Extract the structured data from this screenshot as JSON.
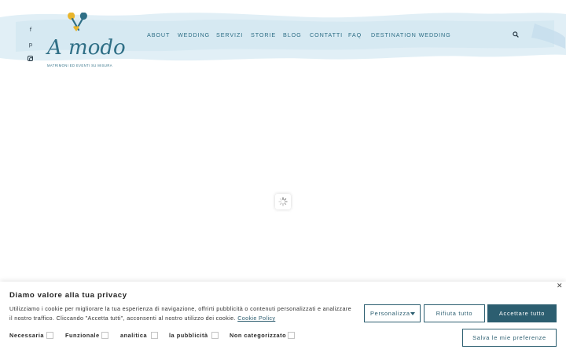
{
  "header": {
    "social_icons": [
      "facebook-icon",
      "pinterest-icon",
      "instagram-icon"
    ],
    "logo_text": "A modo",
    "logo_tagline": "MATRIMONI ED EVENTI SU MISURA",
    "nav": [
      {
        "label": "ABOUT"
      },
      {
        "label": "WEDDING"
      },
      {
        "label": "SERVIZI"
      },
      {
        "label": "STORIE"
      },
      {
        "label": "BLOG"
      },
      {
        "label": "CONTATTI"
      },
      {
        "label": "FAQ"
      },
      {
        "label": "DESTINATION WEDDING"
      }
    ],
    "search_icon": "search-icon",
    "brand_color": "#2f6f86",
    "wash_color": "#d9ebf4"
  },
  "loader": {
    "icon": "loading-spinner-icon"
  },
  "cookie_banner": {
    "title": "Diamo valore alla tua privacy",
    "text": "Utilizziamo i cookie per migliorare la tua esperienza di navigazione, offrirti pubblicità o contenuti personalizzati e analizzare il nostro traffico. Cliccando \"Accetta tutti\", acconsenti al nostro utilizzo dei cookie.",
    "policy_link": "Cookie Policy",
    "buttons": {
      "customize": "Personalizza",
      "reject": "Rifiuta tutto",
      "accept": "Accettare tutto",
      "save": "Salva le mie preferenze"
    },
    "categories": [
      {
        "label": "Necessaria"
      },
      {
        "label": "Funzionale"
      },
      {
        "label": "analitica"
      },
      {
        "label": "la pubblicità"
      },
      {
        "label": "Non categorizzato"
      }
    ],
    "accent_color": "#2c5e70"
  }
}
